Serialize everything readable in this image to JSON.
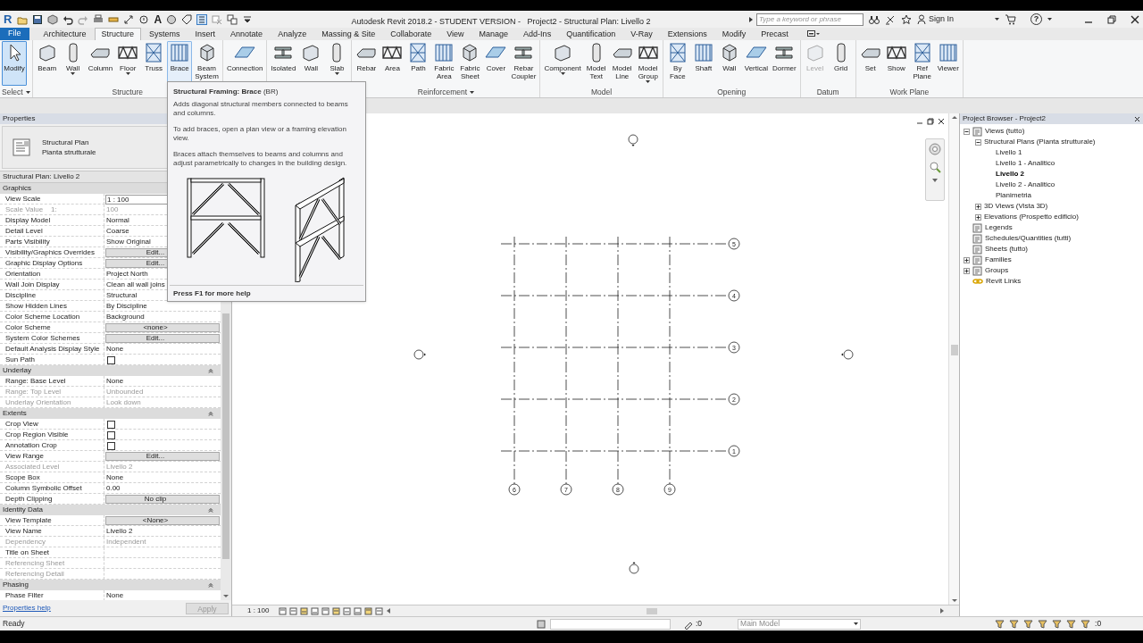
{
  "app_logo": "R",
  "quick_access_text_tool": "A",
  "window": {
    "title": "Autodesk Revit 2018.2 - STUDENT VERSION -   Project2 - Structural Plan: Livello 2"
  },
  "search": {
    "placeholder": "Type a keyword or phrase"
  },
  "sign_in": "Sign In",
  "help_glyph": "?",
  "tabs": [
    {
      "label": "File",
      "kind": "file",
      "selected": false
    },
    {
      "label": "Architecture",
      "kind": "tab",
      "selected": false
    },
    {
      "label": "Structure",
      "kind": "tab",
      "selected": true
    },
    {
      "label": "Systems",
      "kind": "tab",
      "selected": false
    },
    {
      "label": "Insert",
      "kind": "tab",
      "selected": false
    },
    {
      "label": "Annotate",
      "kind": "tab",
      "selected": false
    },
    {
      "label": "Analyze",
      "kind": "tab",
      "selected": false
    },
    {
      "label": "Massing & Site",
      "kind": "tab",
      "selected": false
    },
    {
      "label": "Collaborate",
      "kind": "tab",
      "selected": false
    },
    {
      "label": "View",
      "kind": "tab",
      "selected": false
    },
    {
      "label": "Manage",
      "kind": "tab",
      "selected": false
    },
    {
      "label": "Add-Ins",
      "kind": "tab",
      "selected": false
    },
    {
      "label": "Quantification",
      "kind": "tab",
      "selected": false
    },
    {
      "label": "V-Ray",
      "kind": "tab",
      "selected": false
    },
    {
      "label": "Extensions",
      "kind": "tab",
      "selected": false
    },
    {
      "label": "Modify",
      "kind": "tab",
      "selected": false
    },
    {
      "label": "Precast",
      "kind": "tab",
      "selected": false
    }
  ],
  "ribbon": {
    "panels": [
      {
        "label": "Select",
        "dropdown": true,
        "buttons": [
          {
            "label": "Modify",
            "selected": true,
            "hovered": false,
            "dropdown": false,
            "disabled": false
          }
        ]
      },
      {
        "label": "Structure",
        "dropdown": false,
        "buttons": [
          {
            "label": "Beam",
            "selected": false,
            "hovered": false,
            "dropdown": false,
            "disabled": false
          },
          {
            "label": "Wall",
            "selected": false,
            "hovered": false,
            "dropdown": true,
            "disabled": false
          },
          {
            "label": "Column",
            "selected": false,
            "hovered": false,
            "dropdown": false,
            "disabled": false
          },
          {
            "label": "Floor",
            "selected": false,
            "hovered": false,
            "dropdown": true,
            "disabled": false
          },
          {
            "label": "Truss",
            "selected": false,
            "hovered": false,
            "dropdown": false,
            "disabled": false
          },
          {
            "label": "Brace",
            "selected": false,
            "hovered": true,
            "dropdown": false,
            "disabled": false
          },
          {
            "label": "Beam System",
            "selected": false,
            "hovered": false,
            "dropdown": false,
            "disabled": false
          }
        ]
      },
      {
        "buttons": [
          {
            "label": "Connection",
            "selected": false,
            "hovered": false,
            "dropdown": false,
            "disabled": false
          }
        ]
      },
      {
        "buttons": [
          {
            "label": "Isolated",
            "selected": false,
            "hovered": false,
            "dropdown": false,
            "disabled": false
          },
          {
            "label": "Wall",
            "selected": false,
            "hovered": false,
            "dropdown": false,
            "disabled": false
          },
          {
            "label": "Slab",
            "selected": false,
            "hovered": false,
            "dropdown": true,
            "disabled": false
          }
        ]
      },
      {
        "label": "Reinforcement",
        "dropdown": true,
        "buttons": [
          {
            "label": "Rebar",
            "selected": false,
            "hovered": false,
            "dropdown": false,
            "disabled": false
          },
          {
            "label": "Area",
            "selected": false,
            "hovered": false,
            "dropdown": false,
            "disabled": false
          },
          {
            "label": "Path",
            "selected": false,
            "hovered": false,
            "dropdown": false,
            "disabled": false
          },
          {
            "label": "Fabric Area",
            "selected": false,
            "hovered": false,
            "dropdown": false,
            "disabled": false
          },
          {
            "label": "Fabric Sheet",
            "selected": false,
            "hovered": false,
            "dropdown": false,
            "disabled": false
          },
          {
            "label": "Cover",
            "selected": false,
            "hovered": false,
            "dropdown": false,
            "disabled": false
          },
          {
            "label": "Rebar Coupler",
            "selected": false,
            "hovered": false,
            "dropdown": false,
            "disabled": false
          }
        ]
      },
      {
        "label": "Model",
        "dropdown": false,
        "buttons": [
          {
            "label": "Component",
            "selected": false,
            "hovered": false,
            "dropdown": true,
            "disabled": false
          },
          {
            "label": "Model Text",
            "selected": false,
            "hovered": false,
            "dropdown": false,
            "disabled": false
          },
          {
            "label": "Model Line",
            "selected": false,
            "hovered": false,
            "dropdown": false,
            "disabled": false
          },
          {
            "label": "Model Group",
            "selected": false,
            "hovered": false,
            "dropdown": true,
            "disabled": false
          }
        ]
      },
      {
        "label": "Opening",
        "dropdown": false,
        "buttons": [
          {
            "label": "By Face",
            "selected": false,
            "hovered": false,
            "dropdown": false,
            "disabled": false
          },
          {
            "label": "Shaft",
            "selected": false,
            "hovered": false,
            "dropdown": false,
            "disabled": false
          },
          {
            "label": "Wall",
            "selected": false,
            "hovered": false,
            "dropdown": false,
            "disabled": false
          },
          {
            "label": "Vertical",
            "selected": false,
            "hovered": false,
            "dropdown": false,
            "disabled": false
          },
          {
            "label": "Dormer",
            "selected": false,
            "hovered": false,
            "dropdown": false,
            "disabled": false
          }
        ]
      },
      {
        "label": "Datum",
        "dropdown": false,
        "buttons": [
          {
            "label": "Level",
            "selected": false,
            "hovered": false,
            "dropdown": false,
            "disabled": true
          },
          {
            "label": "Grid",
            "selected": false,
            "hovered": false,
            "dropdown": false,
            "disabled": false
          }
        ]
      },
      {
        "label": "Work Plane",
        "dropdown": false,
        "buttons": [
          {
            "label": "Set",
            "selected": false,
            "hovered": false,
            "dropdown": false,
            "disabled": false
          },
          {
            "label": "Show",
            "selected": false,
            "hovered": false,
            "dropdown": false,
            "disabled": false
          },
          {
            "label": "Ref Plane",
            "selected": false,
            "hovered": false,
            "dropdown": false,
            "disabled": false
          },
          {
            "label": "Viewer",
            "selected": false,
            "hovered": false,
            "dropdown": false,
            "disabled": false
          }
        ]
      }
    ]
  },
  "tooltip": {
    "title": "**Structural Framing: Brace** (BR)",
    "paragraphs": [
      "Adds diagonal structural members connected to beams and columns.",
      "To add braces, open a plan view or a framing elevation view.",
      "Braces attach themselves to beams and columns and adjust parametrically to changes in the building design."
    ],
    "footer": "Press F1 for more help"
  },
  "properties": {
    "title": "Properties",
    "type_name": [
      "Structural Plan",
      "Pianta strutturale"
    ],
    "instance": "Structural Plan: Livello 2",
    "sections": [
      {
        "name": "Graphics",
        "rows": [
          {
            "label": "View Scale",
            "value": "1 : 100",
            "kind": "field",
            "greyed": false
          },
          {
            "label": "Scale Value    1:",
            "value": "100",
            "kind": "text",
            "greyed": true
          },
          {
            "label": "Display Model",
            "value": "Normal",
            "kind": "text",
            "greyed": false
          },
          {
            "label": "Detail Level",
            "value": "Coarse",
            "kind": "text",
            "greyed": false
          },
          {
            "label": "Parts Visibility",
            "value": "Show Original",
            "kind": "text",
            "greyed": false
          },
          {
            "label": "Visibility/Graphics Overrides",
            "value": "Edit...",
            "kind": "button",
            "greyed": false
          },
          {
            "label": "Graphic Display Options",
            "value": "Edit...",
            "kind": "button",
            "greyed": false
          },
          {
            "label": "Orientation",
            "value": "Project North",
            "kind": "text",
            "greyed": false
          },
          {
            "label": "Wall Join Display",
            "value": "Clean all wall joins",
            "kind": "text",
            "greyed": false
          },
          {
            "label": "Discipline",
            "value": "Structural",
            "kind": "text",
            "greyed": false
          },
          {
            "label": "Show Hidden Lines",
            "value": "By Discipline",
            "kind": "text",
            "greyed": false
          },
          {
            "label": "Color Scheme Location",
            "value": "Background",
            "kind": "text",
            "greyed": false
          },
          {
            "label": "Color Scheme",
            "value": "<none>",
            "kind": "button",
            "greyed": false
          },
          {
            "label": "System Color Schemes",
            "value": "Edit...",
            "kind": "button",
            "greyed": false
          },
          {
            "label": "Default Analysis Display Style",
            "value": "None",
            "kind": "text",
            "greyed": false
          },
          {
            "label": "Sun Path",
            "kind": "checkbox",
            "checked": false,
            "greyed": false
          }
        ]
      },
      {
        "name": "Underlay",
        "expanded": true,
        "rows": [
          {
            "label": "Range: Base Level",
            "value": "None",
            "kind": "text",
            "greyed": false
          },
          {
            "label": "Range: Top Level",
            "value": "Unbounded",
            "kind": "text",
            "greyed": true
          },
          {
            "label": "Underlay Orientation",
            "value": "Look down",
            "kind": "text",
            "greyed": true
          }
        ]
      },
      {
        "name": "Extents",
        "expanded": true,
        "rows": [
          {
            "label": "Crop View",
            "kind": "checkbox",
            "checked": false,
            "greyed": false
          },
          {
            "label": "Crop Region Visible",
            "kind": "checkbox",
            "checked": false,
            "greyed": false
          },
          {
            "label": "Annotation Crop",
            "kind": "checkbox",
            "checked": false,
            "greyed": false
          },
          {
            "label": "View Range",
            "value": "Edit...",
            "kind": "button",
            "greyed": false
          },
          {
            "label": "Associated Level",
            "value": "Livello 2",
            "kind": "text",
            "greyed": true
          },
          {
            "label": "Scope Box",
            "value": "None",
            "kind": "text",
            "greyed": false
          },
          {
            "label": "Column Symbolic Offset",
            "value": "0.00",
            "kind": "text",
            "greyed": false
          },
          {
            "label": "Depth Clipping",
            "value": "No clip",
            "kind": "button",
            "greyed": false
          }
        ]
      },
      {
        "name": "Identity Data",
        "expanded": true,
        "rows": [
          {
            "label": "View Template",
            "value": "<None>",
            "kind": "button",
            "greyed": false
          },
          {
            "label": "View Name",
            "value": "Livello 2",
            "kind": "text",
            "greyed": false
          },
          {
            "label": "Dependency",
            "value": "Independent",
            "kind": "text",
            "greyed": true
          },
          {
            "label": "Title on Sheet",
            "kind": "text",
            "greyed": false
          },
          {
            "label": "Referencing Sheet",
            "kind": "text",
            "greyed": true
          },
          {
            "label": "Referencing Detail",
            "kind": "text",
            "greyed": true
          }
        ]
      },
      {
        "name": "Phasing",
        "expanded": true,
        "rows": [
          {
            "label": "Phase Filter",
            "value": "None",
            "kind": "text",
            "greyed": false
          }
        ]
      }
    ],
    "help_link": "Properties help",
    "apply": {
      "label": "Apply",
      "disabled": true
    }
  },
  "canvas": {
    "grids": [
      {
        "label": "5",
        "kind": "horizontal"
      },
      {
        "label": "4",
        "kind": "horizontal"
      },
      {
        "label": "3",
        "kind": "horizontal"
      },
      {
        "label": "2",
        "kind": "horizontal"
      },
      {
        "label": "1",
        "kind": "horizontal"
      },
      {
        "label": "6",
        "kind": "vertical"
      },
      {
        "label": "7",
        "kind": "vertical"
      },
      {
        "label": "8",
        "kind": "vertical"
      },
      {
        "label": "9",
        "kind": "vertical"
      }
    ],
    "view_scale": "1 : 100"
  },
  "project_browser": {
    "title": "Project Browser - Project2",
    "items": [
      {
        "label": "Views (tutto)",
        "selected": false,
        "expanded": true,
        "children": [
          {
            "label": "Structural Plans (Pianta strutturale)",
            "selected": false,
            "expanded": true,
            "children": [
              {
                "label": "Livello 1",
                "selected": false
              },
              {
                "label": "Livello 1 - Analitico",
                "selected": false
              },
              {
                "label": "Livello 2",
                "selected": true
              },
              {
                "label": "Livello 2 - Analitico",
                "selected": false
              },
              {
                "label": "Planimetria",
                "selected": false
              }
            ]
          },
          {
            "label": "3D Views (Vista 3D)",
            "selected": false,
            "expanded": false
          },
          {
            "label": "Elevations (Prospetto edificio)",
            "selected": false,
            "expanded": false
          }
        ]
      },
      {
        "label": "Legends",
        "selected": false
      },
      {
        "label": "Schedules/Quantities (tutti)",
        "selected": false
      },
      {
        "label": "Sheets (tutto)",
        "selected": false
      },
      {
        "label": "Families",
        "selected": false,
        "expanded": false
      },
      {
        "label": "Groups",
        "selected": false,
        "expanded": false
      },
      {
        "label": "Revit Links",
        "selected": false
      }
    ]
  },
  "status_bar": {
    "message": "Ready",
    "selection_count": ":0",
    "workset": "Main Model",
    "filter_count": ":0"
  }
}
